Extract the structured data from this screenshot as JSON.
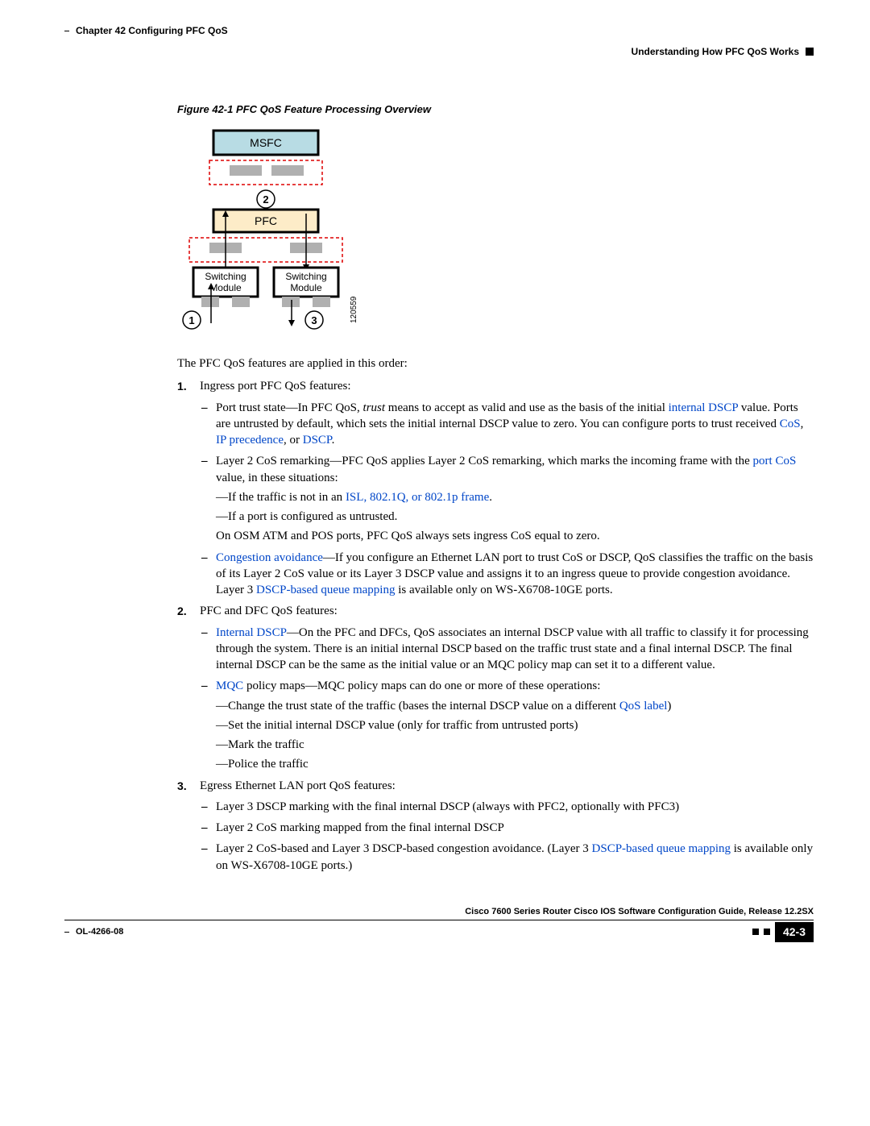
{
  "header": {
    "chapter": "Chapter 42    Configuring PFC QoS",
    "section": "Understanding How PFC QoS Works"
  },
  "figure": {
    "caption": "Figure 42-1  PFC QoS Feature Processing Overview",
    "labels": {
      "msfc": "MSFC",
      "pfc": "PFC",
      "sm1": "Switching",
      "sm1b": "Module",
      "sm2": "Switching",
      "sm2b": "Module",
      "n1": "1",
      "n2": "2",
      "n3": "3",
      "side": "120559"
    }
  },
  "intro": "The PFC QoS features are applied in this order:",
  "list": {
    "i1": {
      "num": "1.",
      "text": "Ingress port PFC QoS features:"
    },
    "i1a_pre": "Port trust state—In PFC QoS, ",
    "i1a_trust": "trust",
    "i1a_mid": " means to accept as valid and use as the basis of the initial ",
    "i1a_link1": "internal DSCP",
    "i1a_mid2": " value. Ports are untrusted by default, which sets the initial internal DSCP value to zero. You can configure ports to trust received ",
    "i1a_link2": "CoS",
    "i1a_link3": "IP precedence",
    "i1a_link4": "DSCP",
    "i1b_pre": "Layer 2 CoS remarking—PFC QoS applies Layer 2 CoS remarking, which marks the incoming frame with the ",
    "i1b_link": "port CoS",
    "i1b_post": " value, in these situations:",
    "i1b_e1_pre": "If the traffic is not in an ",
    "i1b_e1_link": "ISL, 802.1Q, or 802.1p frame",
    "i1b_e2": "If a port is configured as untrusted.",
    "i1b_osm": "On OSM ATM and POS ports, PFC QoS always sets ingress CoS equal to zero.",
    "i1c_link": "Congestion avoidance",
    "i1c_mid": "—If you configure an Ethernet LAN port to trust CoS or DSCP, QoS classifies the traffic on the basis of its Layer 2 CoS value or its Layer 3 DSCP value and assigns it to an ingress queue to provide congestion avoidance. Layer 3 ",
    "i1c_link2": "DSCP-based queue mapping",
    "i1c_post": " is available only on WS-X6708-10GE ports.",
    "i2": {
      "num": "2.",
      "text": "PFC and DFC QoS features:"
    },
    "i2a_link": "Internal DSCP",
    "i2a_post": "—On the PFC and DFCs, QoS associates an internal DSCP value with all traffic to classify it for processing through the system. There is an initial internal DSCP based on the traffic trust state and a final internal DSCP. The final internal DSCP can be the same as the initial value or an MQC policy map can set it to a different value.",
    "i2b_link": "MQC",
    "i2b_post": " policy maps—MQC policy maps can do one or more of these operations:",
    "i2b_e1_pre": "Change the trust state of the traffic (bases the internal DSCP value on a different ",
    "i2b_e1_link": "QoS label",
    "i2b_e1_post": ")",
    "i2b_e2": "Set the initial internal DSCP value (only for traffic from untrusted ports)",
    "i2b_e3": "Mark the traffic",
    "i2b_e4": "Police the traffic",
    "i3": {
      "num": "3.",
      "text": "Egress Ethernet LAN port QoS features:"
    },
    "i3a": "Layer 3 DSCP marking with the final internal DSCP (always with PFC2, optionally with PFC3)",
    "i3b": "Layer 2 CoS marking mapped from the final internal DSCP",
    "i3c_pre": "Layer 2 CoS-based and Layer 3 DSCP-based congestion avoidance. (Layer 3 ",
    "i3c_link": "DSCP-based queue mapping",
    "i3c_post": " is available only on WS-X6708-10GE ports.)"
  },
  "footer": {
    "guide": "Cisco 7600 Series Router Cisco IOS Software Configuration Guide, Release 12.2SX",
    "doc": "OL-4266-08",
    "page": "42-3"
  }
}
